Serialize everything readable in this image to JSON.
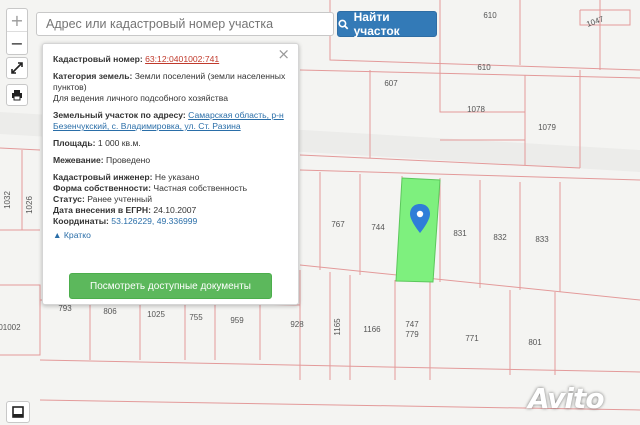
{
  "search": {
    "placeholder": "Адрес или кадастровый номер участка",
    "button_label": "Найти участок"
  },
  "controls": {
    "zoom_in": "+",
    "zoom_out": "−"
  },
  "parcel": {
    "cadastral_label": "Кадастровый номер:",
    "cadastral_value": "63:12:0401002:741",
    "category_label": "Категория земель:",
    "category_value": "Земли поселений (земли населенных пунктов)",
    "usage_value": "Для ведения личного подсобного хозяйства",
    "address_label": "Земельный участок по адресу:",
    "address_value": "Самарская область, р-н Безенчукский, с. Владимировка, ул. Ст. Разина",
    "area_label": "Площадь:",
    "area_value": "1 000 кв.м.",
    "survey_label": "Межевание:",
    "survey_value": "Проведено",
    "engineer_label": "Кадастровый инженер:",
    "engineer_value": "Не указано",
    "ownership_label": "Форма собственности:",
    "ownership_value": "Частная собственность",
    "status_label": "Статус:",
    "status_value": "Ранее учтенный",
    "egrn_label": "Дата внесения в ЕГРН:",
    "egrn_value": "24.10.2007",
    "coords_label": "Координаты:",
    "coords_value": "53.126229, 49.336999",
    "collapse_label": "Кратко",
    "docs_button": "Посмотреть доступные документы"
  },
  "map": {
    "colors": {
      "boundary": "#e39a9a",
      "highlight": "#7ef07e",
      "marker": "#2f7ed8"
    },
    "labels": [
      "610",
      "1047",
      "610",
      "607",
      "1078",
      "1079",
      "1032",
      "1026",
      "767",
      "744",
      "831",
      "832",
      "833",
      "793",
      "806",
      "1025",
      "755",
      "959",
      "928",
      "1165",
      "1166",
      "747",
      "779",
      "771",
      "801",
      "0401002"
    ]
  },
  "watermark": "Avito"
}
